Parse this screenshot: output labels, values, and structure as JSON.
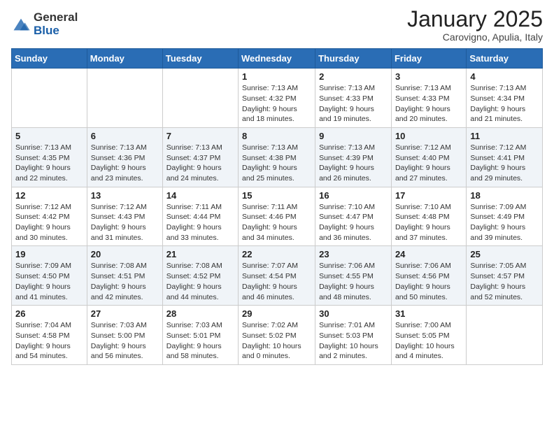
{
  "logo": {
    "general": "General",
    "blue": "Blue"
  },
  "header": {
    "month": "January 2025",
    "location": "Carovigno, Apulia, Italy"
  },
  "weekdays": [
    "Sunday",
    "Monday",
    "Tuesday",
    "Wednesday",
    "Thursday",
    "Friday",
    "Saturday"
  ],
  "weeks": [
    [
      {
        "day": "",
        "sunrise": "",
        "sunset": "",
        "daylight": ""
      },
      {
        "day": "",
        "sunrise": "",
        "sunset": "",
        "daylight": ""
      },
      {
        "day": "",
        "sunrise": "",
        "sunset": "",
        "daylight": ""
      },
      {
        "day": "1",
        "sunrise": "Sunrise: 7:13 AM",
        "sunset": "Sunset: 4:32 PM",
        "daylight": "Daylight: 9 hours and 18 minutes."
      },
      {
        "day": "2",
        "sunrise": "Sunrise: 7:13 AM",
        "sunset": "Sunset: 4:33 PM",
        "daylight": "Daylight: 9 hours and 19 minutes."
      },
      {
        "day": "3",
        "sunrise": "Sunrise: 7:13 AM",
        "sunset": "Sunset: 4:33 PM",
        "daylight": "Daylight: 9 hours and 20 minutes."
      },
      {
        "day": "4",
        "sunrise": "Sunrise: 7:13 AM",
        "sunset": "Sunset: 4:34 PM",
        "daylight": "Daylight: 9 hours and 21 minutes."
      }
    ],
    [
      {
        "day": "5",
        "sunrise": "Sunrise: 7:13 AM",
        "sunset": "Sunset: 4:35 PM",
        "daylight": "Daylight: 9 hours and 22 minutes."
      },
      {
        "day": "6",
        "sunrise": "Sunrise: 7:13 AM",
        "sunset": "Sunset: 4:36 PM",
        "daylight": "Daylight: 9 hours and 23 minutes."
      },
      {
        "day": "7",
        "sunrise": "Sunrise: 7:13 AM",
        "sunset": "Sunset: 4:37 PM",
        "daylight": "Daylight: 9 hours and 24 minutes."
      },
      {
        "day": "8",
        "sunrise": "Sunrise: 7:13 AM",
        "sunset": "Sunset: 4:38 PM",
        "daylight": "Daylight: 9 hours and 25 minutes."
      },
      {
        "day": "9",
        "sunrise": "Sunrise: 7:13 AM",
        "sunset": "Sunset: 4:39 PM",
        "daylight": "Daylight: 9 hours and 26 minutes."
      },
      {
        "day": "10",
        "sunrise": "Sunrise: 7:12 AM",
        "sunset": "Sunset: 4:40 PM",
        "daylight": "Daylight: 9 hours and 27 minutes."
      },
      {
        "day": "11",
        "sunrise": "Sunrise: 7:12 AM",
        "sunset": "Sunset: 4:41 PM",
        "daylight": "Daylight: 9 hours and 29 minutes."
      }
    ],
    [
      {
        "day": "12",
        "sunrise": "Sunrise: 7:12 AM",
        "sunset": "Sunset: 4:42 PM",
        "daylight": "Daylight: 9 hours and 30 minutes."
      },
      {
        "day": "13",
        "sunrise": "Sunrise: 7:12 AM",
        "sunset": "Sunset: 4:43 PM",
        "daylight": "Daylight: 9 hours and 31 minutes."
      },
      {
        "day": "14",
        "sunrise": "Sunrise: 7:11 AM",
        "sunset": "Sunset: 4:44 PM",
        "daylight": "Daylight: 9 hours and 33 minutes."
      },
      {
        "day": "15",
        "sunrise": "Sunrise: 7:11 AM",
        "sunset": "Sunset: 4:46 PM",
        "daylight": "Daylight: 9 hours and 34 minutes."
      },
      {
        "day": "16",
        "sunrise": "Sunrise: 7:10 AM",
        "sunset": "Sunset: 4:47 PM",
        "daylight": "Daylight: 9 hours and 36 minutes."
      },
      {
        "day": "17",
        "sunrise": "Sunrise: 7:10 AM",
        "sunset": "Sunset: 4:48 PM",
        "daylight": "Daylight: 9 hours and 37 minutes."
      },
      {
        "day": "18",
        "sunrise": "Sunrise: 7:09 AM",
        "sunset": "Sunset: 4:49 PM",
        "daylight": "Daylight: 9 hours and 39 minutes."
      }
    ],
    [
      {
        "day": "19",
        "sunrise": "Sunrise: 7:09 AM",
        "sunset": "Sunset: 4:50 PM",
        "daylight": "Daylight: 9 hours and 41 minutes."
      },
      {
        "day": "20",
        "sunrise": "Sunrise: 7:08 AM",
        "sunset": "Sunset: 4:51 PM",
        "daylight": "Daylight: 9 hours and 42 minutes."
      },
      {
        "day": "21",
        "sunrise": "Sunrise: 7:08 AM",
        "sunset": "Sunset: 4:52 PM",
        "daylight": "Daylight: 9 hours and 44 minutes."
      },
      {
        "day": "22",
        "sunrise": "Sunrise: 7:07 AM",
        "sunset": "Sunset: 4:54 PM",
        "daylight": "Daylight: 9 hours and 46 minutes."
      },
      {
        "day": "23",
        "sunrise": "Sunrise: 7:06 AM",
        "sunset": "Sunset: 4:55 PM",
        "daylight": "Daylight: 9 hours and 48 minutes."
      },
      {
        "day": "24",
        "sunrise": "Sunrise: 7:06 AM",
        "sunset": "Sunset: 4:56 PM",
        "daylight": "Daylight: 9 hours and 50 minutes."
      },
      {
        "day": "25",
        "sunrise": "Sunrise: 7:05 AM",
        "sunset": "Sunset: 4:57 PM",
        "daylight": "Daylight: 9 hours and 52 minutes."
      }
    ],
    [
      {
        "day": "26",
        "sunrise": "Sunrise: 7:04 AM",
        "sunset": "Sunset: 4:58 PM",
        "daylight": "Daylight: 9 hours and 54 minutes."
      },
      {
        "day": "27",
        "sunrise": "Sunrise: 7:03 AM",
        "sunset": "Sunset: 5:00 PM",
        "daylight": "Daylight: 9 hours and 56 minutes."
      },
      {
        "day": "28",
        "sunrise": "Sunrise: 7:03 AM",
        "sunset": "Sunset: 5:01 PM",
        "daylight": "Daylight: 9 hours and 58 minutes."
      },
      {
        "day": "29",
        "sunrise": "Sunrise: 7:02 AM",
        "sunset": "Sunset: 5:02 PM",
        "daylight": "Daylight: 10 hours and 0 minutes."
      },
      {
        "day": "30",
        "sunrise": "Sunrise: 7:01 AM",
        "sunset": "Sunset: 5:03 PM",
        "daylight": "Daylight: 10 hours and 2 minutes."
      },
      {
        "day": "31",
        "sunrise": "Sunrise: 7:00 AM",
        "sunset": "Sunset: 5:05 PM",
        "daylight": "Daylight: 10 hours and 4 minutes."
      },
      {
        "day": "",
        "sunrise": "",
        "sunset": "",
        "daylight": ""
      }
    ]
  ]
}
